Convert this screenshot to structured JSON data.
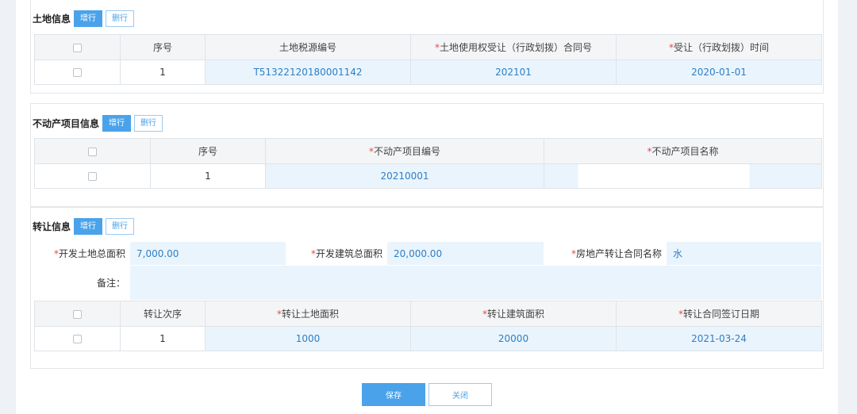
{
  "land": {
    "title": "土地信息",
    "add_label": "增行",
    "del_label": "删行",
    "headers": {
      "seq": "序号",
      "tax_no": "土地税源编号",
      "contract_no": "土地使用权受让（行政划拨）合同号",
      "transfer_time": "受让（行政划拨）时间"
    },
    "rows": [
      {
        "seq": "1",
        "tax_no": "T51322120180001142",
        "contract_no": "202101",
        "transfer_time": "2020-01-01"
      }
    ]
  },
  "property": {
    "title": "不动产项目信息",
    "add_label": "增行",
    "del_label": "删行",
    "headers": {
      "seq": "序号",
      "project_no": "不动产项目编号",
      "project_name": "不动产项目名称"
    },
    "rows": [
      {
        "seq": "1",
        "project_no": "20210001",
        "project_name": ""
      }
    ]
  },
  "transfer": {
    "title": "转让信息",
    "add_label": "增行",
    "del_label": "删行",
    "form": {
      "land_area_label": "开发土地总面积",
      "land_area_value": "7,000.00",
      "build_area_label": "开发建筑总面积",
      "build_area_value": "20,000.00",
      "contract_name_label": "房地产转让合同名称",
      "contract_name_value": "水",
      "remark_label": "备注：",
      "remark_value": ""
    },
    "headers": {
      "seq": "转让次序",
      "land_area": "转让土地面积",
      "build_area": "转让建筑面积",
      "sign_date": "转让合同签订日期"
    },
    "rows": [
      {
        "seq": "1",
        "land_area": "1000",
        "build_area": "20000",
        "sign_date": "2021-03-24"
      }
    ]
  },
  "footer": {
    "save_label": "保存",
    "close_label": "关闭"
  },
  "required_mark": "*"
}
